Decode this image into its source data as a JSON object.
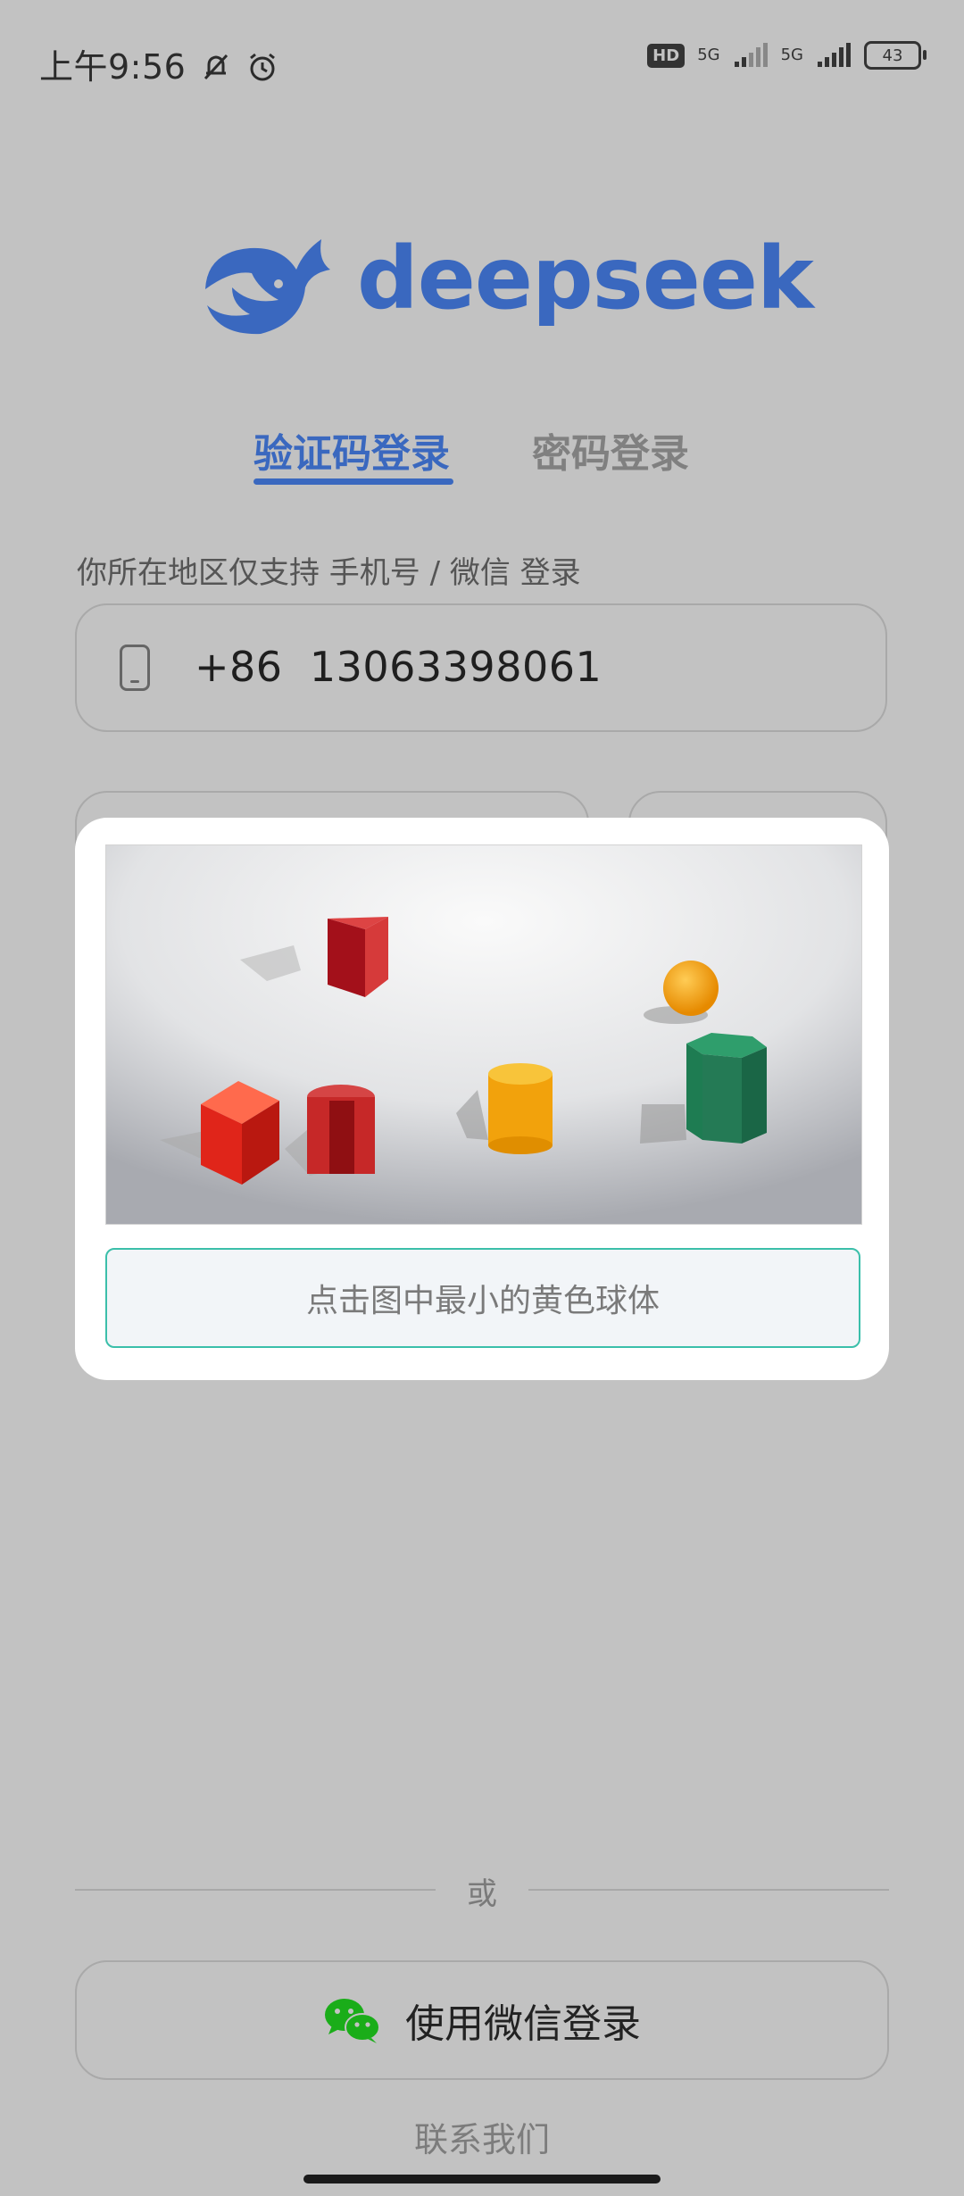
{
  "status_bar": {
    "time": "上午9:56",
    "hd_badge": "HD",
    "network_1": "5G",
    "network_2": "5G",
    "battery": "43",
    "icons": [
      "mute-bell-icon",
      "alarm-icon",
      "signal-icon",
      "signal-icon",
      "battery-icon"
    ]
  },
  "brand": {
    "name": "deepseek",
    "logo_icon": "whale-icon",
    "color": "#3a68bf"
  },
  "tabs": [
    {
      "label": "验证码登录",
      "active": true
    },
    {
      "label": "密码登录",
      "active": false
    }
  ],
  "region_note": "你所在地区仅支持 手机号 / 微信 登录",
  "phone": {
    "country_code": "+86",
    "number": "13063398061",
    "icon": "phone-icon"
  },
  "captcha": {
    "hint": "点击图中最小的黄色球体",
    "accent": "#3bbfaa"
  },
  "alt": {
    "or_text": "或",
    "wechat_label": "使用微信登录",
    "wechat_icon": "wechat-icon",
    "contact": "联系我们"
  }
}
